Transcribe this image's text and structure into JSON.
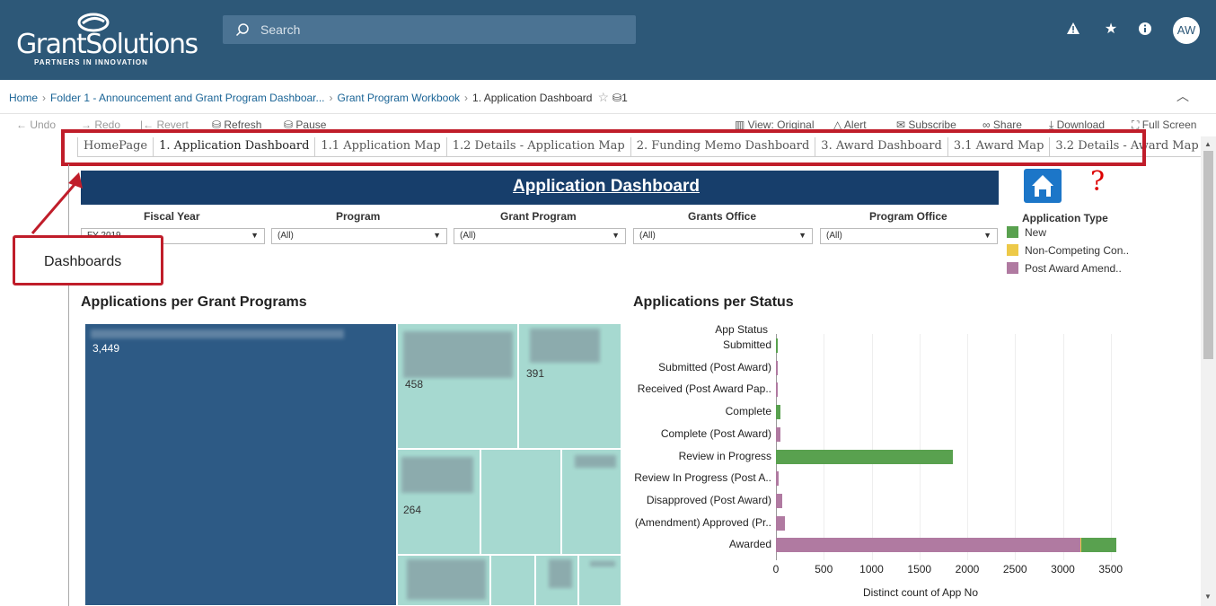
{
  "header": {
    "logo_text": "GrantSolutions",
    "logo_sub": "PARTNERS IN INNOVATION",
    "search_placeholder": "Search",
    "user_initials": "AW"
  },
  "breadcrumb": {
    "items": [
      "Home",
      "Folder 1 - Announcement and Grant Program Dashboar...",
      "Grant Program Workbook",
      "1. Application Dashboard"
    ],
    "data_source_count": "1"
  },
  "toolbar": {
    "undo": "Undo",
    "redo": "Redo",
    "revert": "Revert",
    "refresh": "Refresh",
    "pause": "Pause",
    "view": "View: Original",
    "alert": "Alert",
    "subscribe": "Subscribe",
    "share": "Share",
    "download": "Download",
    "fullscreen": "Full Screen"
  },
  "tabs": [
    "HomePage",
    "1. Application Dashboard",
    "1.1 Application Map",
    "1.2 Details - Application Map",
    "2. Funding Memo Dashboard",
    "3. Award Dashboard",
    "3.1 Award Map",
    "3.2 Details - Award Map"
  ],
  "active_tab": 1,
  "dashboard": {
    "title": "Application Dashboard",
    "callout": "Dashboards",
    "filters": [
      {
        "label": "Fiscal Year",
        "value": "FY 2019"
      },
      {
        "label": "Program",
        "value": "(All)"
      },
      {
        "label": "Grant Program",
        "value": "(All)"
      },
      {
        "label": "Grants Office",
        "value": "(All)"
      },
      {
        "label": "Program Office",
        "value": "(All)"
      }
    ],
    "legend": {
      "title": "Application Type",
      "items": [
        {
          "label": "New",
          "color": "#59a14f"
        },
        {
          "label": "Non-Competing Con..",
          "color": "#edc948"
        },
        {
          "label": "Post Award Amend..",
          "color": "#b07aa1"
        }
      ]
    },
    "treemap_title": "Applications per Grant Programs",
    "treemap_values": [
      "3,449",
      "458",
      "391",
      "264"
    ],
    "bar_title": "Applications per Status"
  },
  "chart_data": {
    "type": "bar",
    "orientation": "horizontal",
    "stacked": true,
    "title": "Applications per Status",
    "ylabel": "App Status",
    "xlabel": "Distinct count of App No",
    "xlim": [
      0,
      3600
    ],
    "xticks": [
      0,
      500,
      1000,
      1500,
      2000,
      2500,
      3000,
      3500
    ],
    "categories": [
      "Submitted",
      "Submitted (Post Award)",
      "Received (Post Award Pap..",
      "Complete",
      "Complete (Post Award)",
      "Review in Progress",
      "Review In Progress (Post A..",
      "Disapproved (Post Award)",
      "(Amendment) Approved (Pr..",
      "Awarded"
    ],
    "series": [
      {
        "name": "Post Award Amend..",
        "color": "#b07aa1",
        "values": [
          0,
          15,
          15,
          0,
          50,
          0,
          30,
          70,
          90,
          3180
        ]
      },
      {
        "name": "Non-Competing Con..",
        "color": "#edc948",
        "values": [
          0,
          0,
          0,
          0,
          0,
          0,
          0,
          0,
          0,
          15
        ]
      },
      {
        "name": "New",
        "color": "#59a14f",
        "values": [
          10,
          0,
          0,
          50,
          0,
          1850,
          0,
          0,
          0,
          360
        ]
      }
    ]
  }
}
